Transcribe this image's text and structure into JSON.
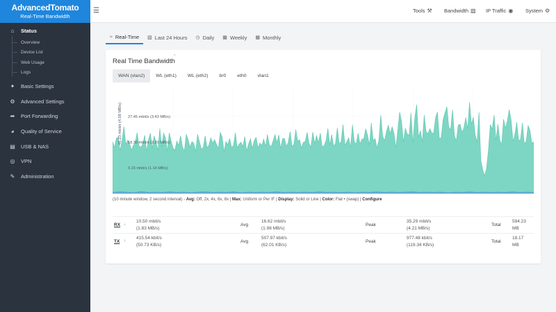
{
  "app": {
    "title": "AdvancedTomato",
    "subtitle": "Real-Time Bandwidth"
  },
  "colors": {
    "brand": "#1e86dd",
    "sidebar": "#2b333e",
    "graph_fill": "#7dd6c3",
    "rx_arrow": "#2aa77a",
    "tx_arrow": "#1e86dd"
  },
  "sidebar": {
    "status": {
      "label": "Status",
      "icon": "home-icon"
    },
    "sub_items": [
      "Overview",
      "Device List",
      "Web Usage",
      "Logs"
    ],
    "items": [
      {
        "label": "Basic Settings",
        "icon": "wrench-icon"
      },
      {
        "label": "Advanced Settings",
        "icon": "gear-icon"
      },
      {
        "label": "Port Forwarding",
        "icon": "forward-icon"
      },
      {
        "label": "Quality of Service",
        "icon": "gauge-icon"
      },
      {
        "label": "USB & NAS",
        "icon": "drive-icon"
      },
      {
        "label": "VPN",
        "icon": "globe-icon"
      },
      {
        "label": "Administration",
        "icon": "pencil-icon"
      }
    ]
  },
  "topbar": {
    "menus": [
      {
        "label": "Tools",
        "icon": "tools-icon"
      },
      {
        "label": "Bandwidth",
        "icon": "chart-icon"
      },
      {
        "label": "IP Traffic",
        "icon": "globe-icon"
      },
      {
        "label": "System",
        "icon": "gear-icon"
      }
    ]
  },
  "tabs": [
    {
      "label": "Real-Time",
      "icon": "chart-icon"
    },
    {
      "label": "Last 24 Hours",
      "icon": "bar-chart-icon"
    },
    {
      "label": "Daily",
      "icon": "clock-icon"
    },
    {
      "label": "Weekly",
      "icon": "calendar-icon"
    },
    {
      "label": "Monthly",
      "icon": "calendar-icon"
    }
  ],
  "card": {
    "title": "Real Time Bandwidth",
    "title_mark": "˜"
  },
  "interfaces": [
    "WAN (vlan2)",
    "WL (eth1)",
    "WL (eth2)",
    "br0",
    "eth0",
    "vlan1"
  ],
  "chart_data": {
    "type": "area",
    "y_axis_label": "45.23 mbit/s (4.58 MB/s)",
    "grid_labels": [
      "27.45 mbit/s (3.43 MB/s)",
      "18.30 mbit/s (2.29 MB/s)",
      "9.15 mbit/s (1.14 MB/s)"
    ],
    "grid_values_mbit": [
      27.45,
      18.3,
      9.15
    ],
    "ylim_mbit": [
      0,
      36.6
    ],
    "series": [
      {
        "values": [
          18.5,
          16.4,
          19.7,
          20.1,
          15.3,
          18.9,
          23.9,
          17.5,
          19.0,
          17.9,
          15.4,
          17.2,
          18.1,
          21.7,
          16.9,
          16.5,
          17.6,
          20.8,
          15.1,
          19.1,
          21.5,
          16.1,
          20.5,
          18.3,
          15.3,
          23.2,
          16.6,
          21.5,
          19.8,
          15.1,
          21.6,
          18.7,
          16.2,
          15.4,
          18.7,
          17.1,
          20.6,
          16.6,
          15.1,
          21.1,
          19.2,
          16.5,
          18.5,
          17.9,
          15.0,
          21.1,
          18.4,
          15.8,
          16.4,
          20.5,
          16.3,
          17.2,
          19.8,
          18.0,
          19.2,
          17.6,
          16.0,
          21.8,
          20.2,
          14.9,
          18.5,
          17.4,
          19.6,
          16.4,
          17.1,
          21.7,
          16.3,
          17.6,
          18.3,
          16.7,
          20.3,
          15.1,
          17.7,
          19.5,
          16.1,
          18.9,
          20.0,
          16.2,
          18.0,
          17.1,
          19.4,
          16.8,
          21.0,
          17.3,
          16.7,
          18.8,
          21.0,
          18.1,
          20.9,
          16.0,
          19.6,
          19.6,
          16.8,
          18.2,
          22.1,
          16.7,
          17.5,
          22.8,
          18.7,
          19.1,
          16.3,
          18.2,
          18.5,
          21.8,
          17.9,
          16.5,
          21.9,
          17.8,
          20.7,
          18.1,
          21.5,
          16.6,
          17.1,
          18.8,
          23.2,
          17.2,
          21.0,
          16.9,
          17.8,
          23.4,
          17.6,
          18.5,
          24.6,
          17.3,
          18.4,
          19.9,
          16.4,
          24.5,
          18.3,
          17.6,
          21.5,
          17.6,
          19.4,
          19.4,
          23.1,
          20.8,
          17.2,
          25.2,
          18.8,
          19.6,
          16.2,
          18.9,
          28.0,
          20.4,
          18.8,
          22.1,
          24.4,
          21.3,
          23.8,
          21.5,
          16.3,
          22.6,
          29.0,
          25.7,
          18.2,
          23.3,
          21.2,
          20.7,
          28.8,
          17.9,
          26.9,
          31.7,
          20.1,
          22.4,
          18.4,
          28.0,
          22.0,
          21.3,
          23.1,
          21.6,
          21.5,
          27.0,
          29.1,
          19.6,
          19.9,
          26.4,
          28.8,
          30.9,
          23.7,
          22.7,
          29.9,
          20.6,
          18.7,
          24.3,
          24.7,
          21.8,
          23.3,
          27.1,
          23.0,
          32.5,
          24.6,
          27.2,
          20.8,
          18.3,
          29.0,
          11.7,
          8.4,
          6.3,
          9.0,
          15.5,
          24.5,
          23.0,
          28.0,
          18.9,
          24.7,
          19.1,
          17.3,
          26.5,
          23.2,
          25.8,
          29.9,
          26.2,
          18.6,
          21.0,
          25.4,
          18.8,
          19.3,
          25.2,
          17.6,
          18.7,
          24.3,
          22.4,
          17.8,
          18.5
        ],
        "tx_values": [
          0.5,
          0.7,
          0.6,
          0.4,
          0.8,
          0.5,
          0.6,
          0.5,
          0.7,
          0.5,
          0.6,
          0.4,
          0.6,
          0.7,
          0.5,
          0.6,
          0.5,
          0.7,
          0.4,
          0.6,
          0.5,
          0.6,
          0.5,
          0.7,
          0.5,
          0.6,
          0.5,
          0.6,
          0.5,
          0.7,
          0.5,
          0.6,
          0.5,
          0.6,
          0.4,
          0.6,
          0.5,
          0.7,
          0.5,
          0.6,
          0.5,
          0.6,
          0.7,
          0.5,
          0.6,
          0.5,
          0.6,
          0.4,
          0.6,
          0.5,
          0.7,
          0.5,
          0.6,
          0.5,
          0.6,
          0.5,
          0.7,
          0.5,
          0.6,
          0.5
        ]
      }
    ]
  },
  "options_text": {
    "prefix": "(10 minute window, 2 second interval) - ",
    "avg_label": "Avg:",
    "avg_opts": "Off, 2x, 4x, 6x, 8x",
    "sep1": " | ",
    "max_label": "Max:",
    "max_opts": "Uniform or Per IF",
    "sep2": " | ",
    "display_label": "Display:",
    "display_opts": "Solid or Line",
    "sep3": " | ",
    "color_label": "Color:",
    "color_opts": "Flat • (swap)",
    "sep4": " | ",
    "configure": "Configure"
  },
  "stats": {
    "headers": {
      "avg": "Avg",
      "peak": "Peak",
      "total": "Total"
    },
    "rx": {
      "label": "RX",
      "arrow": "↓",
      "current_mbit": "10.50 mbit/s",
      "current_mb": "(1.83 MB/s)",
      "avg_mbit": "16.62 mbit/s",
      "avg_mb": "(1.98 MB/s)",
      "peak_mbit": "35.29 mbit/s",
      "peak_mb": "(4.21 MB/s)",
      "total": "594.23",
      "total_unit": "MB"
    },
    "tx": {
      "label": "TX",
      "arrow": "↑",
      "current_mbit": "415.54 kbit/s",
      "current_mb": "(50.73 KB/s)",
      "avg_mbit": "507.97 kbit/s",
      "avg_mb": "(62.01 KB/s)",
      "peak_mbit": "977.48 kbit/s",
      "peak_mb": "(119.34 KB/s)",
      "total": "18.17",
      "total_unit": "MB"
    }
  }
}
